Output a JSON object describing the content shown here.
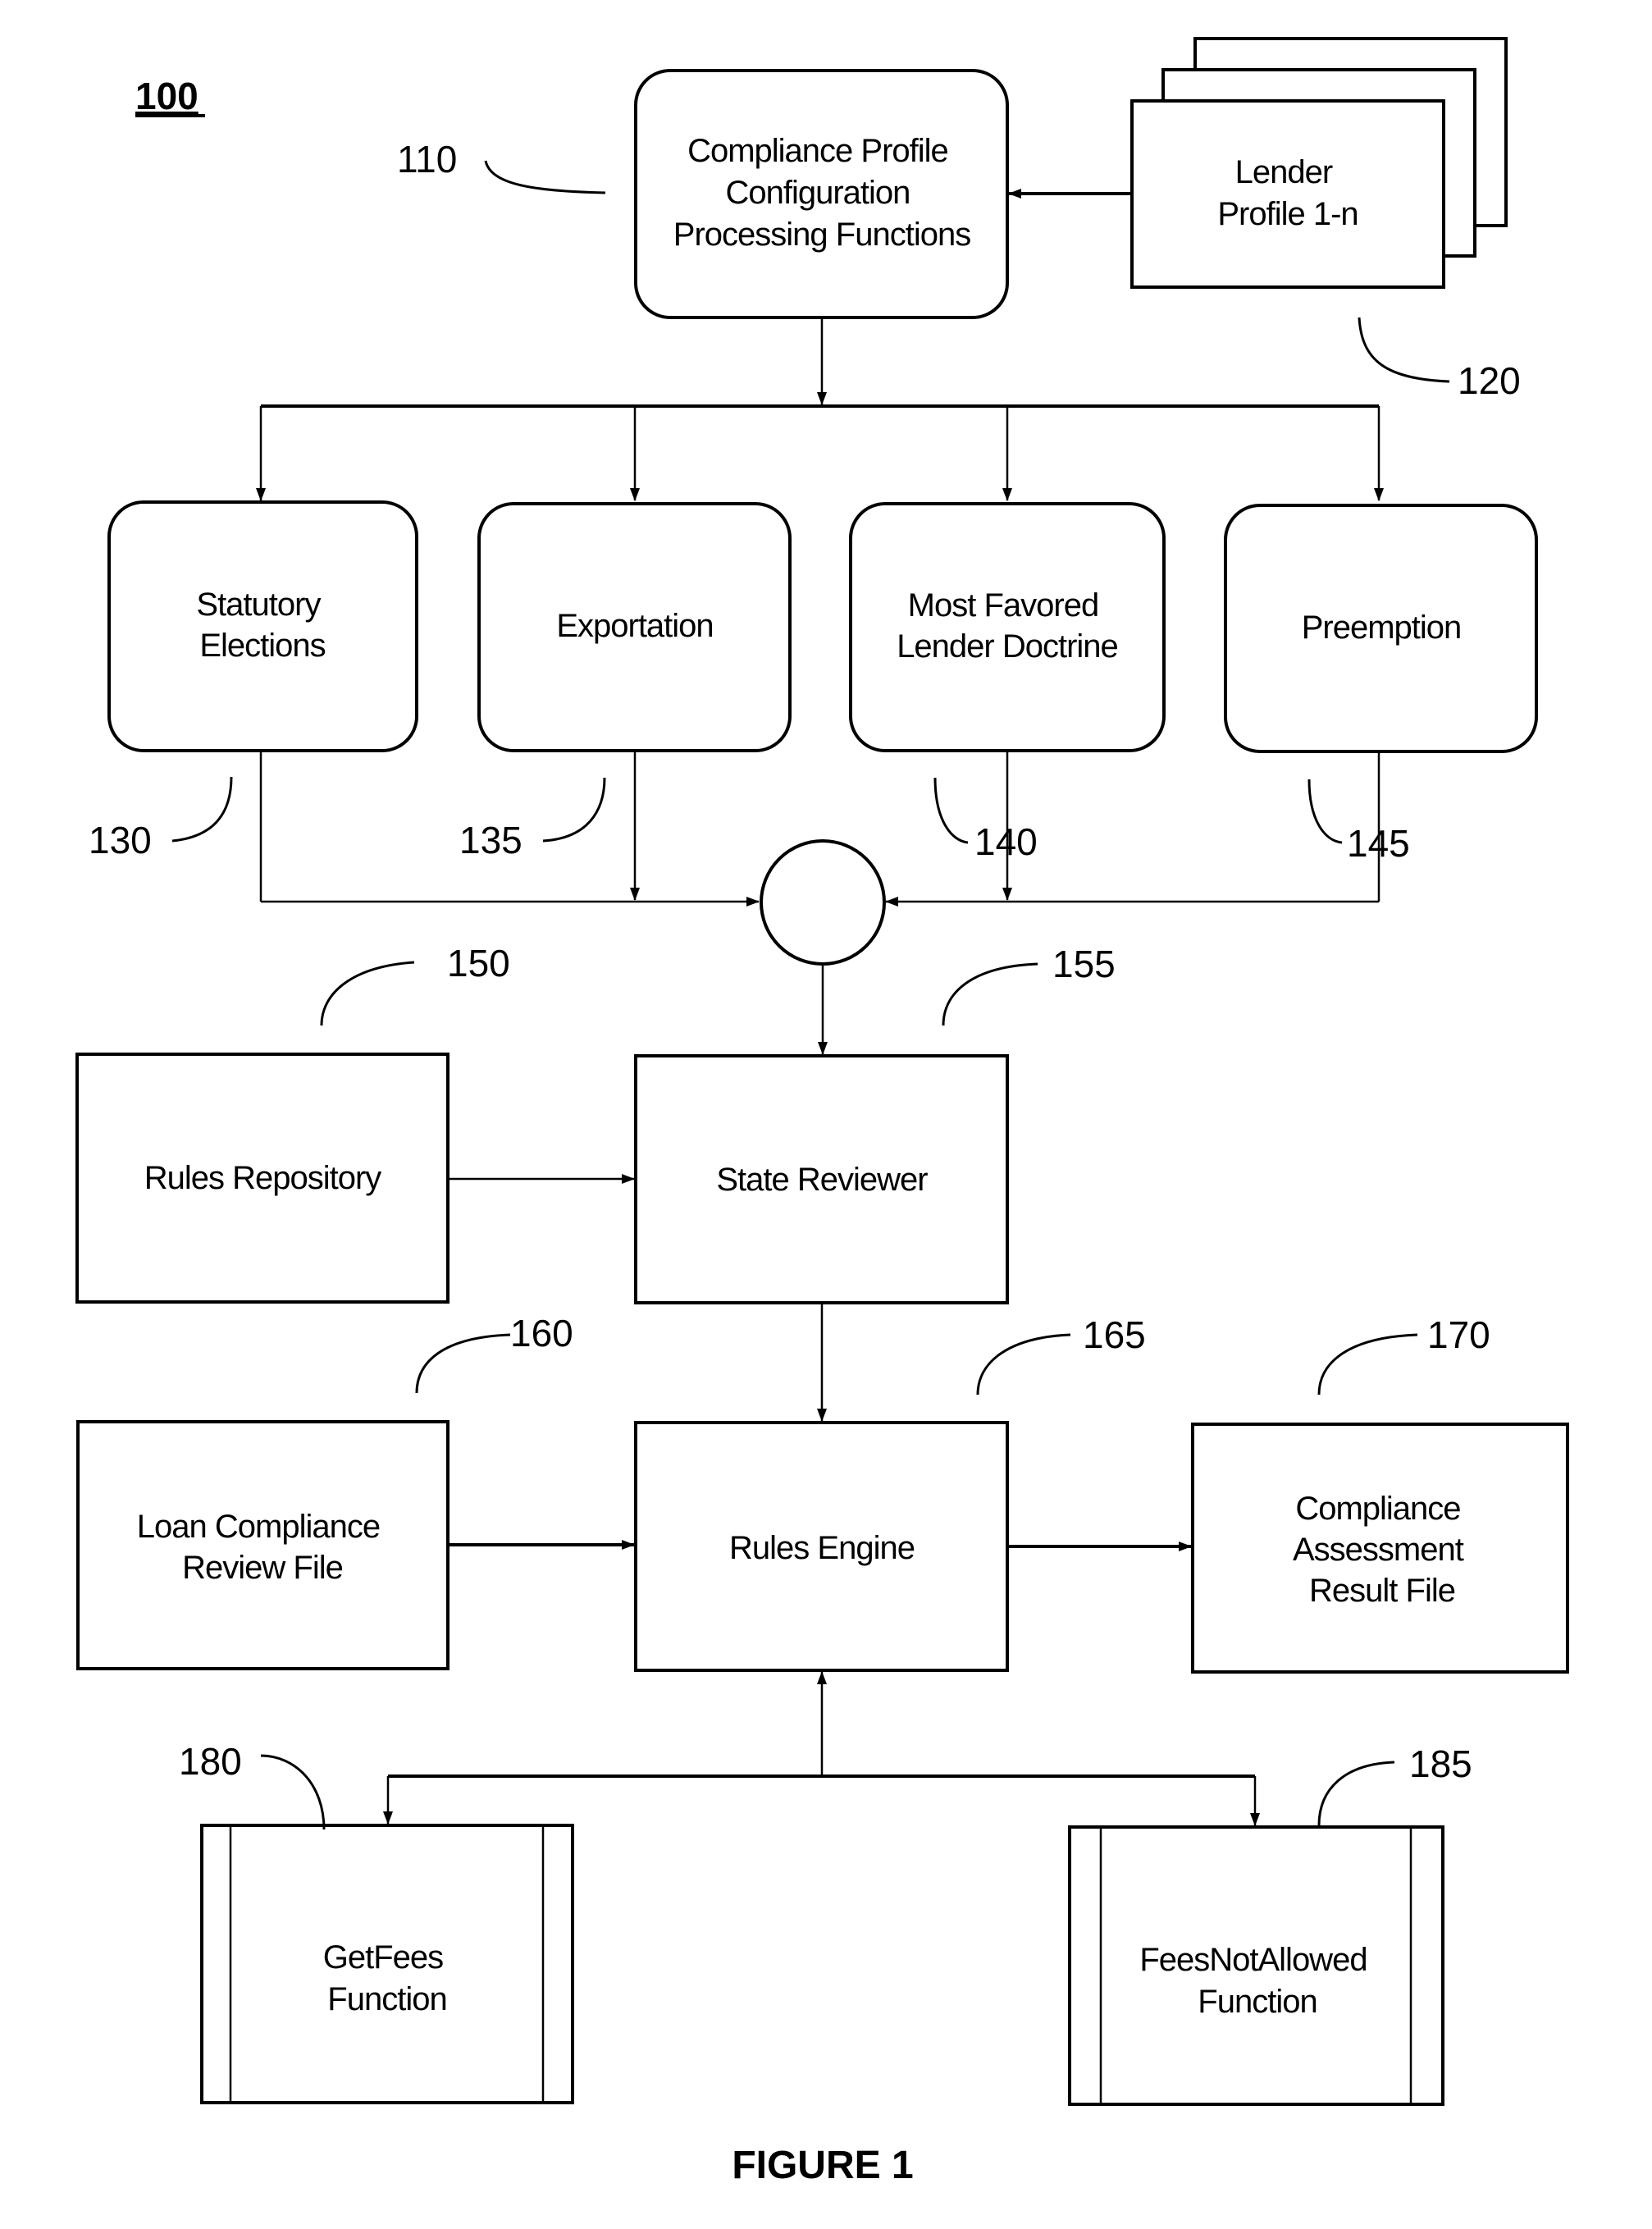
{
  "figure": {
    "number": "100",
    "caption": "FIGURE 1"
  },
  "nodes": {
    "compliance_profile": {
      "ref": "110",
      "lines": [
        "Compliance Profile",
        "Configuration",
        "Processing Functions"
      ]
    },
    "lender_profile": {
      "ref": "120",
      "lines": [
        "Lender",
        "Profile 1-n"
      ]
    },
    "statutory_elections": {
      "ref": "130",
      "lines": [
        "Statutory",
        "Elections"
      ]
    },
    "exportation": {
      "ref": "135",
      "lines": [
        "Exportation"
      ]
    },
    "most_favored": {
      "ref": "140",
      "lines": [
        "Most Favored",
        "Lender Doctrine"
      ]
    },
    "preemption": {
      "ref": "145",
      "lines": [
        "Preemption"
      ]
    },
    "rules_repository": {
      "ref": "150",
      "lines": [
        "Rules Repository"
      ]
    },
    "state_reviewer": {
      "ref": "155",
      "lines": [
        "State Reviewer"
      ]
    },
    "loan_compliance": {
      "ref": "160",
      "lines": [
        "Loan Compliance",
        "Review File"
      ]
    },
    "rules_engine": {
      "ref": "165",
      "lines": [
        "Rules Engine"
      ]
    },
    "assessment_result": {
      "ref": "170",
      "lines": [
        "Compliance",
        "Assessment",
        "Result File"
      ]
    },
    "get_fees": {
      "ref": "180",
      "lines": [
        "GetFees",
        "Function"
      ]
    },
    "fees_not_allowed": {
      "ref": "185",
      "lines": [
        "FeesNotAllowed",
        "Function"
      ]
    }
  },
  "edges": [
    {
      "from": "lender_profile",
      "to": "compliance_profile"
    },
    {
      "from": "compliance_profile",
      "to": "statutory_elections"
    },
    {
      "from": "compliance_profile",
      "to": "exportation"
    },
    {
      "from": "compliance_profile",
      "to": "most_favored"
    },
    {
      "from": "compliance_profile",
      "to": "preemption"
    },
    {
      "from": "statutory_elections",
      "to": "junction"
    },
    {
      "from": "exportation",
      "to": "junction"
    },
    {
      "from": "most_favored",
      "to": "junction"
    },
    {
      "from": "preemption",
      "to": "junction"
    },
    {
      "from": "junction",
      "to": "state_reviewer"
    },
    {
      "from": "rules_repository",
      "to": "state_reviewer"
    },
    {
      "from": "state_reviewer",
      "to": "rules_engine"
    },
    {
      "from": "loan_compliance",
      "to": "rules_engine"
    },
    {
      "from": "rules_engine",
      "to": "assessment_result"
    },
    {
      "from": "rules_engine",
      "to": "get_fees",
      "bidirectional": true
    },
    {
      "from": "rules_engine",
      "to": "fees_not_allowed",
      "bidirectional": true
    }
  ]
}
